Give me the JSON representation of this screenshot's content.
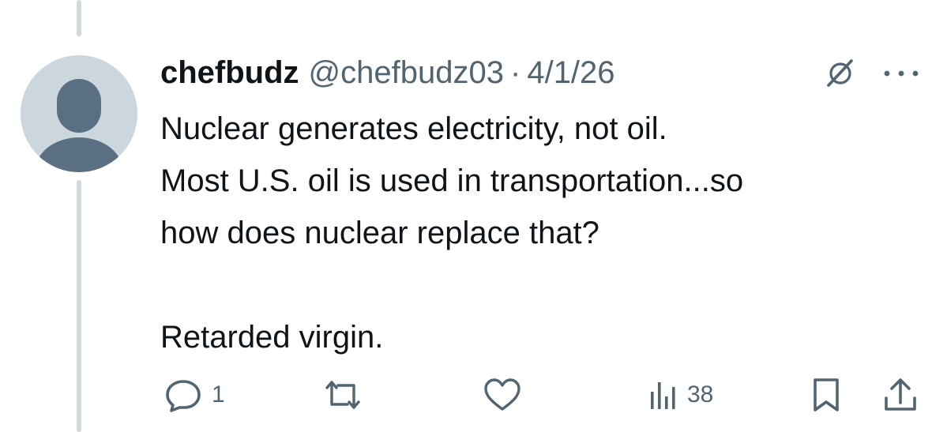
{
  "colors": {
    "text_primary": "#0f1419",
    "text_secondary": "#536471",
    "thread_line": "#cfd9de",
    "avatar_bg": "#ccd6dd",
    "avatar_figure": "#5b6f82"
  },
  "tweet": {
    "display_name": "chefbudz",
    "handle": "@chefbudz03",
    "separator": "·",
    "date": "4/1/26",
    "lines": [
      "Nuclear generates electricity, not oil.",
      "Most U.S. oil is used in transportation...so",
      "how does nuclear replace that?"
    ],
    "closing_line": "Retarded virgin."
  },
  "actions": {
    "reply_count": "1",
    "repost_count": "",
    "like_count": "",
    "views_count": "38"
  },
  "icons": {
    "header": [
      "grok-icon",
      "more-icon"
    ],
    "action_bar": [
      "reply-icon",
      "repost-icon",
      "like-icon",
      "views-icon",
      "bookmark-icon",
      "share-icon"
    ]
  }
}
